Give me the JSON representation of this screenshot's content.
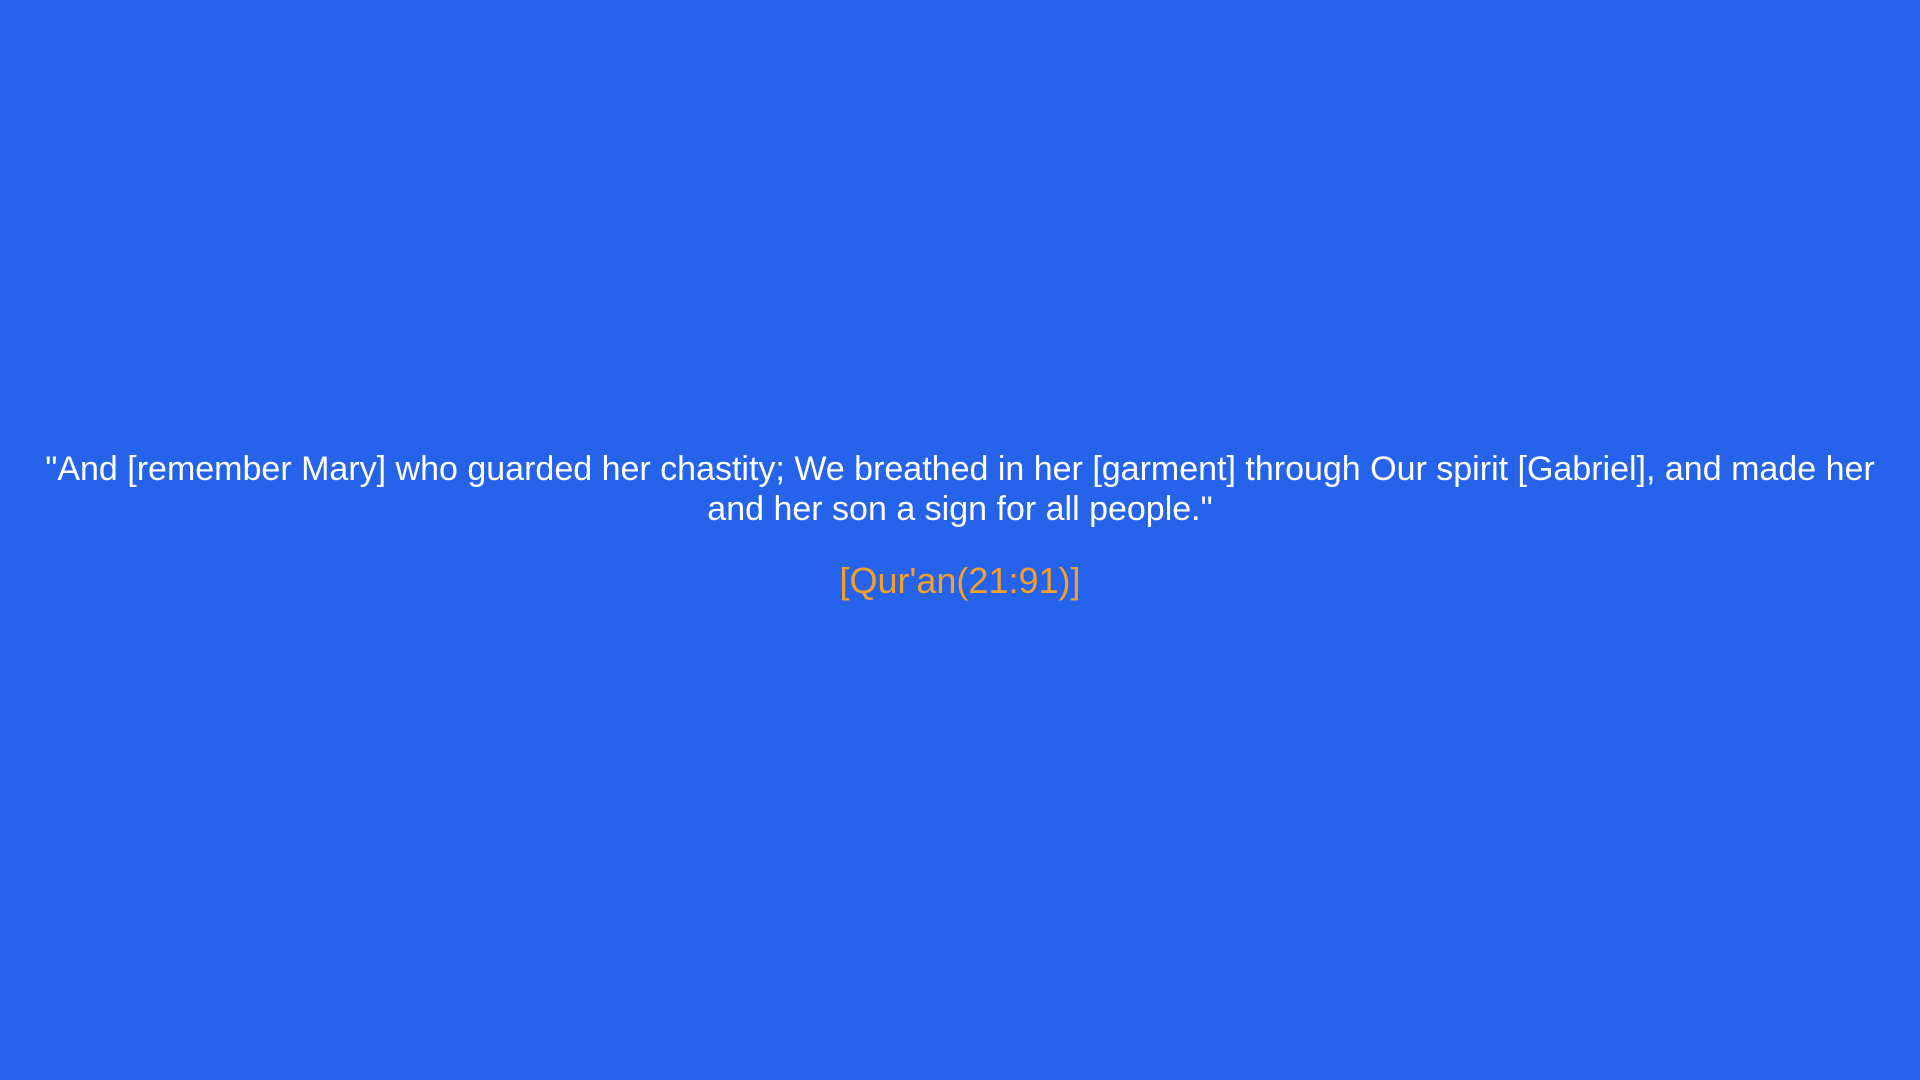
{
  "quote": {
    "text": "\"And [remember Mary] who guarded her chastity; We breathed in her [garment] through Our spirit [Gabriel], and made her and her son a sign for all people.\"",
    "source": "[Qur'an(21:91)]"
  },
  "colors": {
    "background": "#2563eb",
    "quote_text": "#ffffff",
    "source_text": "#f59e2a"
  }
}
